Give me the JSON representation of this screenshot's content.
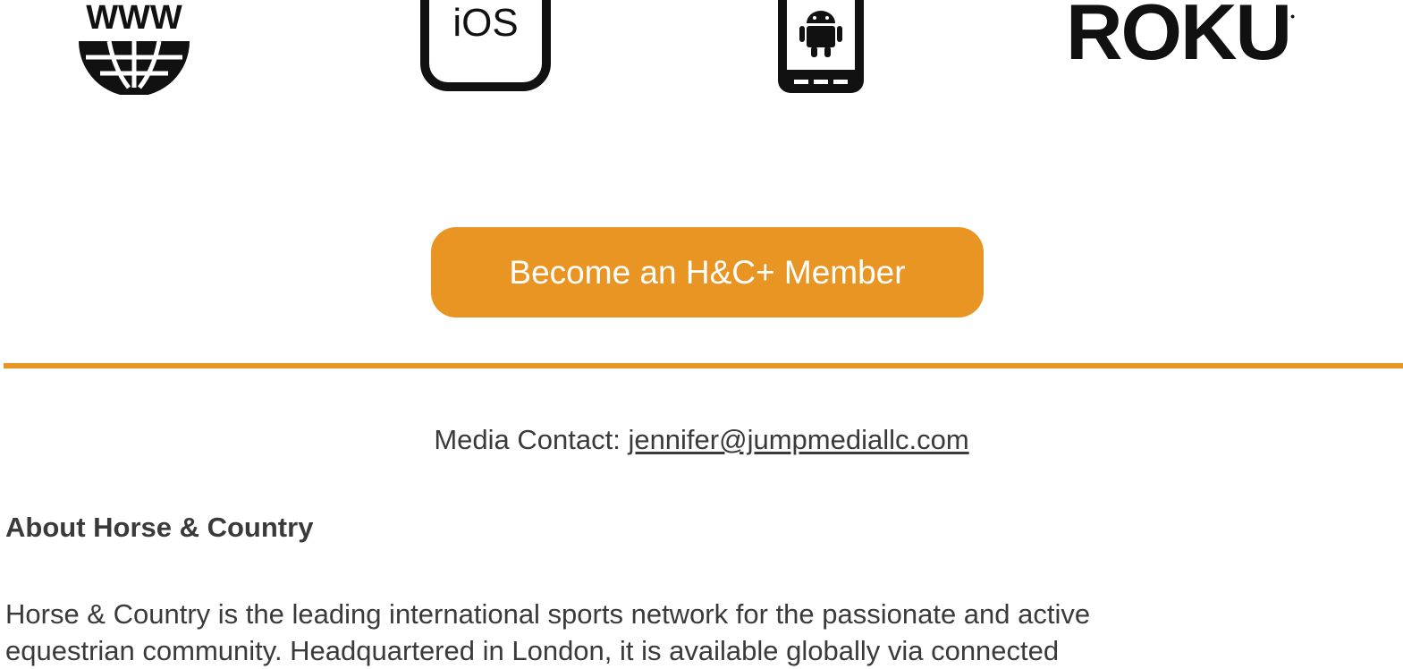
{
  "platforms": {
    "web_text": "WWW",
    "ios_text": "iOS",
    "roku_text": "ROKU"
  },
  "cta": {
    "label": "Become an H&C+ Member"
  },
  "contact": {
    "prefix": "Media Contact: ",
    "email": "jennifer@jumpmediallc.com"
  },
  "about": {
    "heading": "About Horse & Country",
    "line1": "Horse & Country is the leading international sports network for the passionate and active",
    "line2": "equestrian community. Headquartered in London, it is available globally via connected"
  },
  "colors": {
    "accent": "#e99524",
    "text": "#3a3a3a",
    "icon": "#111111"
  }
}
